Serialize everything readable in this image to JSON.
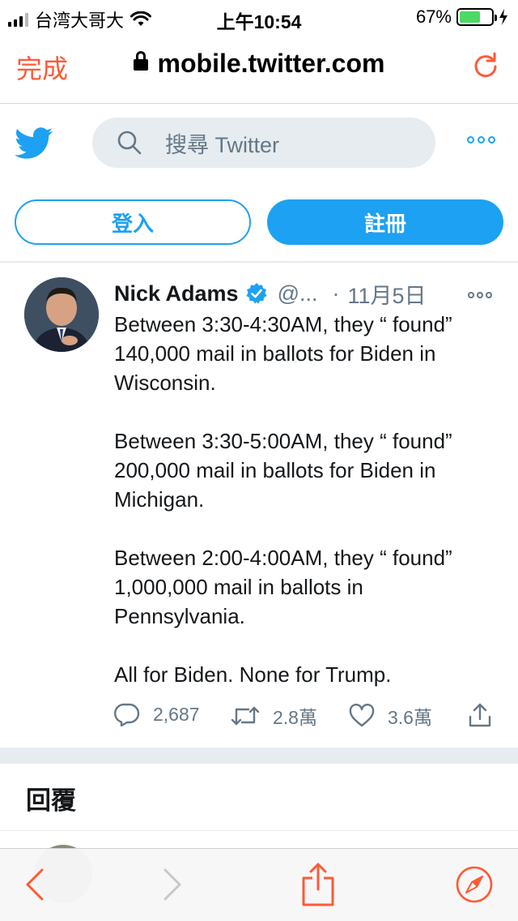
{
  "status_bar": {
    "carrier": "台湾大哥大",
    "time": "上午10:54",
    "battery_percent": "67%",
    "battery_level": 0.67
  },
  "browser": {
    "done_label": "完成",
    "url": "mobile.twitter.com"
  },
  "twitter_header": {
    "search_placeholder": "搜尋 Twitter"
  },
  "auth": {
    "login_label": "登入",
    "signup_label": "註冊"
  },
  "tweet": {
    "author_name": "Nick Adams",
    "handle": "@...",
    "separator": "·",
    "date": "11月5日",
    "paragraphs": [
      "Between 3:30-4:30AM, they “ found” 140,000 mail in ballots for Biden in Wisconsin.",
      "Between 3:30-5:00AM, they “ found” 200,000 mail in ballots for Biden in Michigan.",
      "Between 2:00-4:00AM, they “ found” 1,000,000 mail in ballots in Pennsylvania.",
      "All for Biden. None for Trump."
    ],
    "replies_count": "2,687",
    "retweets_count": "2.8萬",
    "likes_count": "3.6萬"
  },
  "replies_section": {
    "title": "回覆"
  },
  "colors": {
    "twitter_blue": "#1da1f2",
    "safari_accent": "#ff5a36",
    "muted_text": "#657786"
  }
}
